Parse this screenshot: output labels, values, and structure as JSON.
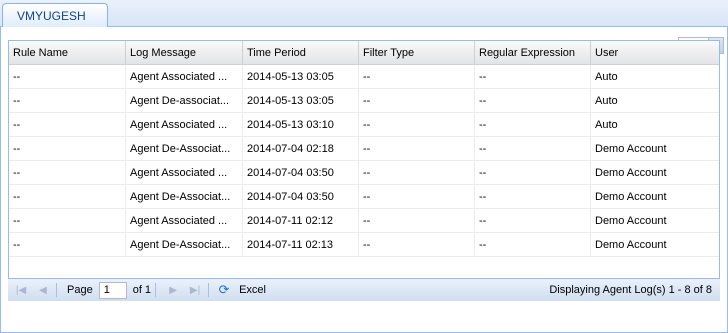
{
  "tab": {
    "label": "VMYUGESH"
  },
  "page_size": {
    "value": "15"
  },
  "grid": {
    "columns": [
      "Rule Name",
      "Log Message",
      "Time Period",
      "Filter Type",
      "Regular Expression",
      "User"
    ],
    "rows": [
      [
        "--",
        "Agent Associated ...",
        "2014-05-13 03:05",
        "--",
        "--",
        "Auto"
      ],
      [
        "--",
        "Agent De-associat...",
        "2014-05-13 03:05",
        "--",
        "--",
        "Auto"
      ],
      [
        "--",
        "Agent Associated ...",
        "2014-05-13 03:10",
        "--",
        "--",
        "Auto"
      ],
      [
        "--",
        "Agent De-Associat...",
        "2014-07-04 02:18",
        "--",
        "--",
        "Demo Account"
      ],
      [
        "--",
        "Agent Associated ...",
        "2014-07-04 03:50",
        "--",
        "--",
        "Demo Account"
      ],
      [
        "--",
        "Agent De-Associat...",
        "2014-07-04 03:50",
        "--",
        "--",
        "Demo Account"
      ],
      [
        "--",
        "Agent Associated ...",
        "2014-07-11 02:12",
        "--",
        "--",
        "Demo Account"
      ],
      [
        "--",
        "Agent De-Associat...",
        "2014-07-11 02:13",
        "--",
        "--",
        "Demo Account"
      ]
    ]
  },
  "toolbar": {
    "page_label": "Page",
    "page_value": "1",
    "of_label": "of 1",
    "excel_label": "Excel",
    "display_text": "Displaying Agent Log(s) 1 - 8 of 8"
  },
  "icons": {
    "first": "first-page-icon",
    "prev": "prev-page-icon",
    "next": "next-page-icon",
    "last": "last-page-icon",
    "refresh": "refresh-icon",
    "dropdown": "chevron-down-icon"
  }
}
